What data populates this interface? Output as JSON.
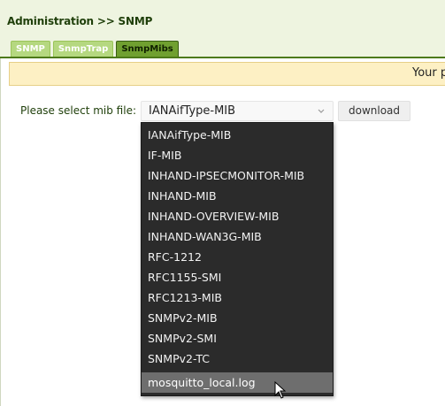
{
  "breadcrumb": "Administration >> SNMP",
  "tabs": [
    {
      "label": "SNMP",
      "active": false
    },
    {
      "label": "SnmpTrap",
      "active": false
    },
    {
      "label": "SnmpMibs",
      "active": true
    }
  ],
  "notice": {
    "text": "Your p"
  },
  "form": {
    "label": "Please select mib file:",
    "selected_value": "IANAifType-MIB",
    "download_label": "download"
  },
  "dropdown": {
    "options": [
      "IANAifType-MIB",
      "IF-MIB",
      "INHAND-IPSECMONITOR-MIB",
      "INHAND-MIB",
      "INHAND-OVERVIEW-MIB",
      "INHAND-WAN3G-MIB",
      "RFC-1212",
      "RFC1155-SMI",
      "RFC1213-MIB",
      "SNMPv2-MIB",
      "SNMPv2-SMI",
      "SNMPv2-TC",
      "mosquitto_local.log"
    ],
    "highlighted_index": 12
  },
  "colors": {
    "header_bg": "#eef4e0",
    "tab_active": "#70a030",
    "tab_inactive": "#b5d880",
    "notice_bg": "#fdf0c4",
    "dropdown_bg": "#2b2b2b",
    "dropdown_highlight": "#6e6e6e"
  },
  "icons": {
    "select_chevron": "chevron-down-icon",
    "cursor": "mouse-pointer-icon"
  }
}
